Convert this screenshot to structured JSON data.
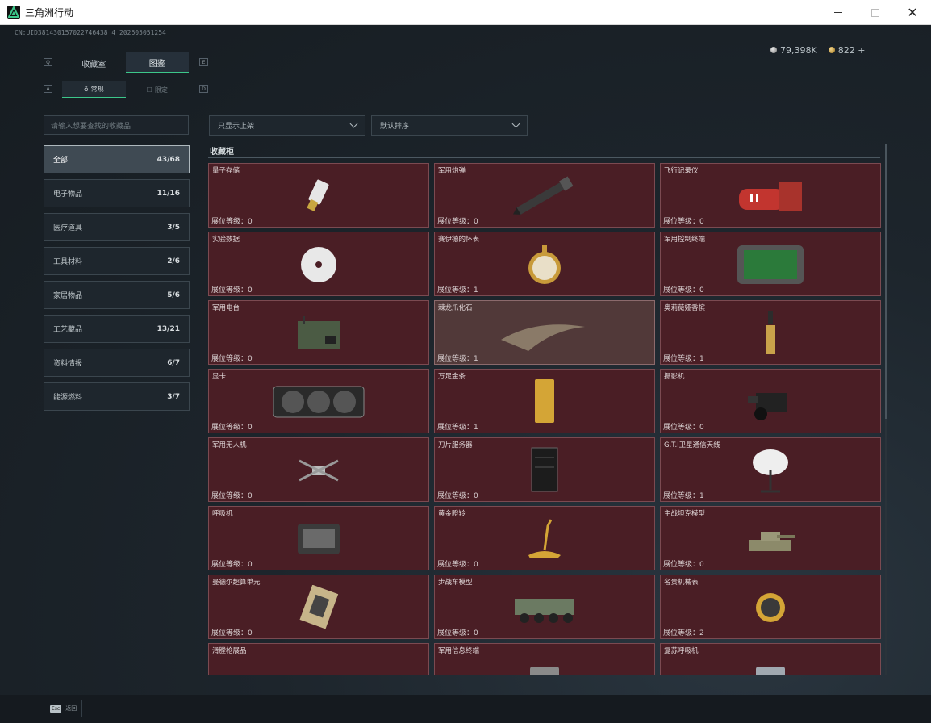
{
  "window": {
    "title": "三角洲行动"
  },
  "uid": "CN:UID381430157022746438 4_202605051254",
  "currency": {
    "silver": "79,398K",
    "gold": "822",
    "gold_plus": "+"
  },
  "tabs": {
    "items": [
      {
        "label": "收藏室"
      },
      {
        "label": "图鉴"
      }
    ],
    "key_left": "Q",
    "key_right": "E"
  },
  "subtabs": {
    "items": [
      {
        "label": "常规"
      },
      {
        "label": "限定"
      }
    ],
    "key_left": "A",
    "key_right": "D"
  },
  "search": {
    "placeholder": "请输入想要查找的收藏品"
  },
  "categories": [
    {
      "name": "全部",
      "count": "43/68"
    },
    {
      "name": "电子物品",
      "count": "11/16"
    },
    {
      "name": "医疗道具",
      "count": "3/5"
    },
    {
      "name": "工具材料",
      "count": "2/6"
    },
    {
      "name": "家居物品",
      "count": "5/6"
    },
    {
      "name": "工艺藏品",
      "count": "13/21"
    },
    {
      "name": "资料情报",
      "count": "6/7"
    },
    {
      "name": "能源燃料",
      "count": "3/7"
    }
  ],
  "filters": {
    "shelf": "只显示上架",
    "sort": "默认排序"
  },
  "section_title": "收藏柜",
  "items": [
    {
      "name": "量子存储",
      "level": "展位等级：0",
      "icon": "usb-drive-icon"
    },
    {
      "name": "军用炮弹",
      "level": "展位等级：0",
      "icon": "artillery-shell-icon"
    },
    {
      "name": "飞行记录仪",
      "level": "展位等级：0",
      "icon": "flight-recorder-icon"
    },
    {
      "name": "实验数据",
      "level": "展位等级：0",
      "icon": "disc-icon"
    },
    {
      "name": "赛伊德的怀表",
      "level": "展位等级：1",
      "icon": "pocket-watch-icon"
    },
    {
      "name": "军用控制终端",
      "level": "展位等级：0",
      "icon": "control-terminal-icon"
    },
    {
      "name": "军用电台",
      "level": "展位等级：0",
      "icon": "radio-icon"
    },
    {
      "name": "棘龙爪化石",
      "level": "展位等级：1",
      "icon": "claw-fossil-icon"
    },
    {
      "name": "奥莉薇娅香槟",
      "level": "展位等级：1",
      "icon": "champagne-icon"
    },
    {
      "name": "显卡",
      "level": "展位等级：0",
      "icon": "graphics-card-icon"
    },
    {
      "name": "万足金条",
      "level": "展位等级：1",
      "icon": "gold-bar-icon"
    },
    {
      "name": "摄影机",
      "level": "展位等级：0",
      "icon": "camera-icon"
    },
    {
      "name": "军用无人机",
      "level": "展位等级：0",
      "icon": "drone-icon"
    },
    {
      "name": "刀片服务器",
      "level": "展位等级：0",
      "icon": "server-icon"
    },
    {
      "name": "G.T.I卫星通信天线",
      "level": "展位等级：1",
      "icon": "satellite-dish-icon"
    },
    {
      "name": "呼吸机",
      "level": "展位等级：0",
      "icon": "ventilator-icon"
    },
    {
      "name": "黄金瞪羚",
      "level": "展位等级：0",
      "icon": "gold-gazelle-icon"
    },
    {
      "name": "主战坦克模型",
      "level": "展位等级：0",
      "icon": "tank-model-icon"
    },
    {
      "name": "曼德尔超算单元",
      "level": "展位等级：0",
      "icon": "supercompute-unit-icon"
    },
    {
      "name": "步战车模型",
      "level": "展位等级：0",
      "icon": "ifv-model-icon"
    },
    {
      "name": "名贵机械表",
      "level": "展位等级：2",
      "icon": "wristwatch-icon"
    },
    {
      "name": "滑膛枪展品",
      "level": "",
      "icon": "musket-icon"
    },
    {
      "name": "军用信息终端",
      "level": "",
      "icon": "info-terminal-icon"
    },
    {
      "name": "复苏呼吸机",
      "level": "",
      "icon": "resuscitator-icon"
    }
  ],
  "footer": {
    "key": "Esc",
    "label": "返回"
  }
}
